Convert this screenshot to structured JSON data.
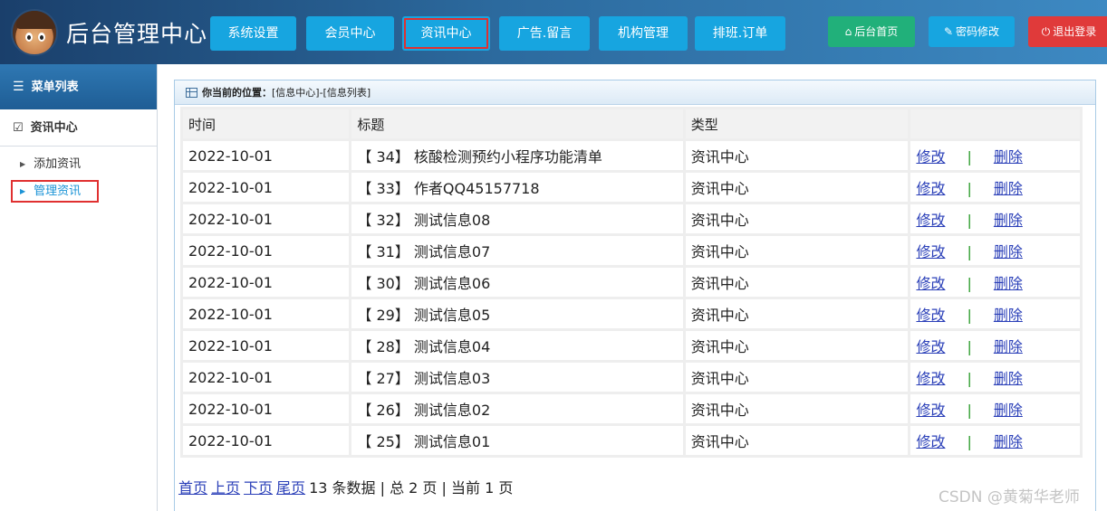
{
  "header": {
    "title": "后台管理中心",
    "nav": [
      {
        "label": "系统设置",
        "active": false
      },
      {
        "label": "会员中心",
        "active": false
      },
      {
        "label": "资讯中心",
        "active": true
      },
      {
        "label": "广告.留言",
        "active": false
      },
      {
        "label": "机构管理",
        "active": false
      },
      {
        "label": "排班.订单",
        "active": false
      }
    ],
    "tools": {
      "home_label": "后台首页",
      "password_label": "密码修改",
      "logout_label": "退出登录"
    }
  },
  "sidebar": {
    "menu_title": "菜单列表",
    "section_title": "资讯中心",
    "items": [
      {
        "label": "添加资讯",
        "active": false
      },
      {
        "label": "管理资讯",
        "active": true
      }
    ]
  },
  "main": {
    "location_label": "你当前的位置：",
    "location_path": "[信息中心]-[信息列表]",
    "columns": [
      "时间",
      "标题",
      "类型",
      ""
    ],
    "rows": [
      {
        "time": "2022-10-01",
        "title": "【 34】 核酸检测预约小程序功能清单",
        "type": "资讯中心"
      },
      {
        "time": "2022-10-01",
        "title": "【 33】 作者QQ45157718",
        "type": "资讯中心"
      },
      {
        "time": "2022-10-01",
        "title": "【 32】 测试信息08",
        "type": "资讯中心"
      },
      {
        "time": "2022-10-01",
        "title": "【 31】 测试信息07",
        "type": "资讯中心"
      },
      {
        "time": "2022-10-01",
        "title": "【 30】 测试信息06",
        "type": "资讯中心"
      },
      {
        "time": "2022-10-01",
        "title": "【 29】 测试信息05",
        "type": "资讯中心"
      },
      {
        "time": "2022-10-01",
        "title": "【 28】 测试信息04",
        "type": "资讯中心"
      },
      {
        "time": "2022-10-01",
        "title": "【 27】 测试信息03",
        "type": "资讯中心"
      },
      {
        "time": "2022-10-01",
        "title": "【 26】 测试信息02",
        "type": "资讯中心"
      },
      {
        "time": "2022-10-01",
        "title": "【 25】 测试信息01",
        "type": "资讯中心"
      }
    ],
    "edit_label": "修改",
    "separator": "|",
    "delete_label": "删除",
    "pager": {
      "first": "首页",
      "prev": "上页",
      "next": "下页",
      "last": "尾页",
      "summary": "13 条数据 | 总 2 页 | 当前 1 页"
    }
  },
  "watermark": "CSDN @黄菊华老师",
  "colors": {
    "nav_button": "#17a5e0",
    "home_button": "#21b07a",
    "logout_button": "#e03a3a",
    "highlight_box": "#e03030",
    "link": "#2a3fb8"
  }
}
